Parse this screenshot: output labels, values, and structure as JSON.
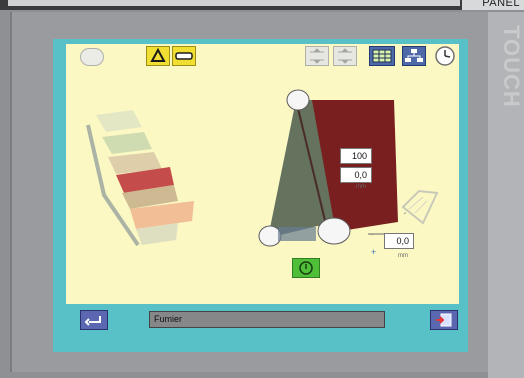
{
  "frame": {
    "panel_label": "PANEL",
    "touch_label": "TOUCH"
  },
  "toolbar": {
    "icons": [
      "gear-icon",
      "recycle-icon",
      "cylinder-icon",
      "step-icon",
      "step-icon",
      "table-icon",
      "network-icon",
      "clock-icon"
    ]
  },
  "conveyor": {
    "speed_value": "100",
    "tension_value": "0,0",
    "tension_unit": "mm",
    "offset_value": "0,0",
    "offset_unit": "mm",
    "offset_sign_minus": "-",
    "offset_sign_plus": "+"
  },
  "status": {
    "material_name": "Fumier"
  },
  "colors": {
    "screen_bg": "#fbf8c4",
    "frame_teal": "#58c1c8",
    "belt_red": "#7a1f1f",
    "belt_green": "#64725e",
    "start_green": "#4fbf3a"
  }
}
